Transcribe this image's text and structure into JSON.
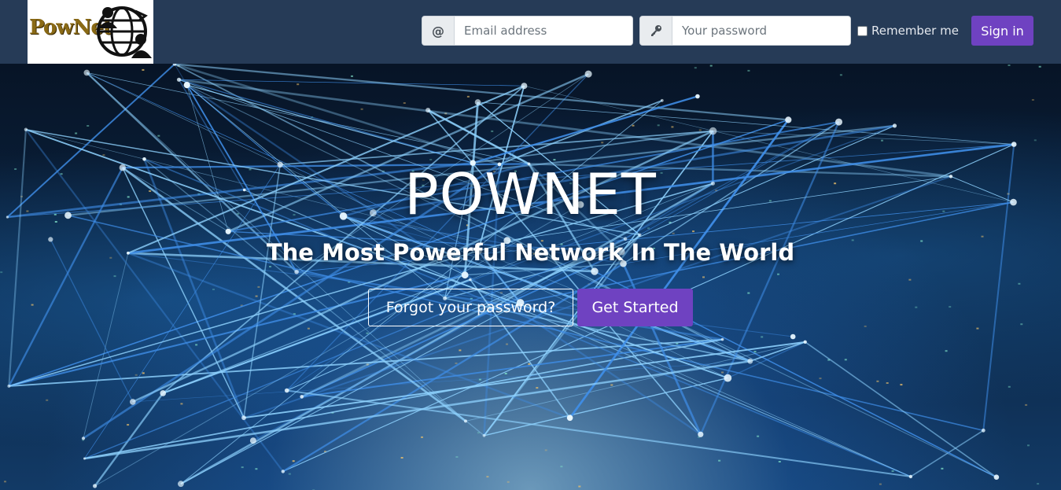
{
  "brand": {
    "logo_text": "PowNet",
    "logo_icon": "globe-people-icon"
  },
  "login": {
    "email_addon": "@",
    "email_placeholder": "Email address",
    "password_icon": "key-icon",
    "password_placeholder": "Your password",
    "remember_label": "Remember me",
    "remember_checked": false,
    "signin_label": "Sign in"
  },
  "hero": {
    "title": "POWNET",
    "subtitle": "The Most Powerful Network In The World",
    "forgot_label": "Forgot your password?",
    "get_started_label": "Get Started"
  },
  "colors": {
    "navbar": "#263b57",
    "accent": "#6f42c1",
    "network_glow": "#8fd3ff"
  }
}
